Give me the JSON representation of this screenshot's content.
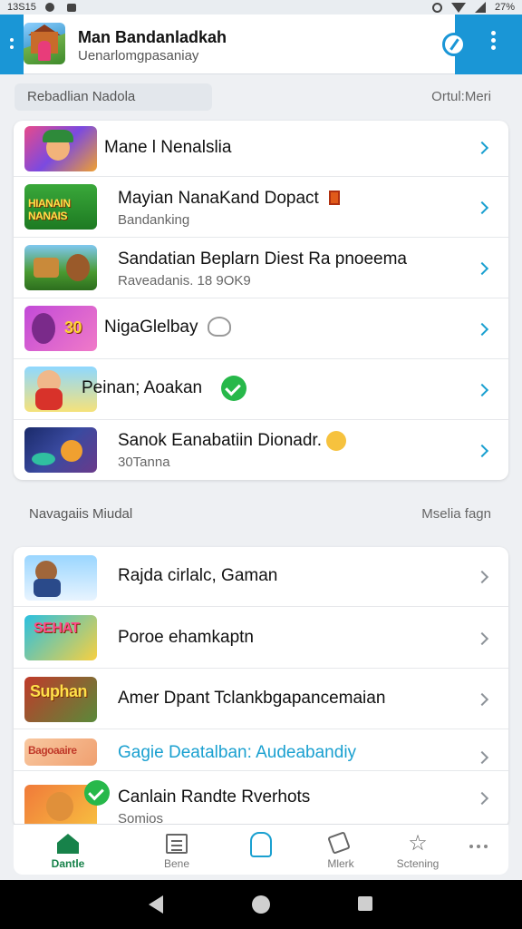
{
  "status_bar": {
    "time": "13S15",
    "battery": "27%"
  },
  "header": {
    "title": "Man Bandanladkah",
    "subtitle": "Uenarlomgpasaniay"
  },
  "section1": {
    "label": "Rebadlian Nadola",
    "action": "Ortul:Meri"
  },
  "list1": [
    {
      "title": "Mane l Nenalslia",
      "subtitle": "",
      "thumb_text": ""
    },
    {
      "title": "Mayian NanaKand Dopact",
      "subtitle": "Bandanking",
      "thumb_text": "HIANAIN NANAIS"
    },
    {
      "title": "Sandatian Beplarn Diest Ra pnoeema",
      "subtitle": "Raveadanis. 18 9OK9",
      "thumb_text": ""
    },
    {
      "title": "NigaGlelbay",
      "subtitle": "",
      "thumb_text": "30"
    },
    {
      "title": "Peinan; Aoakan",
      "subtitle": "",
      "thumb_text": ""
    },
    {
      "title": "Sanok Eanabatiin Dionadr.",
      "subtitle": "30Tanna",
      "thumb_text": ""
    }
  ],
  "section2": {
    "label": "Navagaiis Miudal",
    "action": "Mselia fagn"
  },
  "list2": [
    {
      "title": "Rajda cirlalc, Gaman",
      "subtitle": "",
      "thumb_text": ""
    },
    {
      "title": "Poroe ehamkaptn",
      "subtitle": "",
      "thumb_text": "SEHAT"
    },
    {
      "title": "Amer Dpant Tclankbgapancemaian",
      "subtitle": "",
      "thumb_text": "Suphan"
    },
    {
      "title": "Gagie Deatalban: Audeabandiy",
      "subtitle": "",
      "thumb_text": "Bagoaaire"
    },
    {
      "title": "Canlain Randte Rverhots",
      "subtitle": "Somios",
      "thumb_text": ""
    }
  ],
  "bottom_nav": [
    {
      "label": "Dantle",
      "icon": "home-icon"
    },
    {
      "label": "Bene",
      "icon": "document-icon"
    },
    {
      "label": "",
      "icon": "bag-icon"
    },
    {
      "label": "Mlerk",
      "icon": "tag-icon"
    },
    {
      "label": "Sctening",
      "icon": "star-icon"
    },
    {
      "label": "",
      "icon": "more-icon"
    }
  ],
  "colors": {
    "accent": "#1a96d6",
    "nav_active": "#17824a",
    "check": "#27b84a",
    "link_row": "#1aa0d0"
  }
}
